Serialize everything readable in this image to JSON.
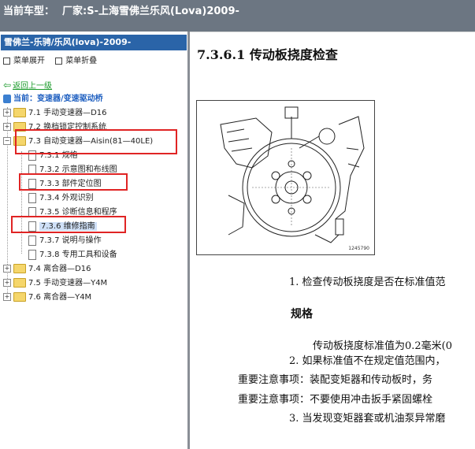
{
  "top_bar": {
    "car_model_label": "当前车型：",
    "manufacturer": "厂家:S-上海雪佛兰乐风(Lova)2009-"
  },
  "left_panel": {
    "header": "雪佛兰-乐骋/乐风(lova)-2009-",
    "expand_label": "菜单展开",
    "collapse_label": "菜单折叠",
    "back_link": "返回上一级",
    "current_path": "当前：变速器/变速驱动桥",
    "tree": [
      {
        "label": "7.1 手动变速器—D16",
        "type": "folder"
      },
      {
        "label": "7.2 换档锁定控制系统",
        "type": "folder"
      },
      {
        "label": "7.3 自动变速器—Aisin(81—40LE)",
        "type": "folder",
        "expanded": true
      },
      {
        "label": "7.3.1 规格",
        "type": "doc"
      },
      {
        "label": "7.3.2 示意图和布线图",
        "type": "doc"
      },
      {
        "label": "7.3.3 部件定位图",
        "type": "doc"
      },
      {
        "label": "7.3.4 外观识别",
        "type": "doc"
      },
      {
        "label": "7.3.5 诊断信息和程序",
        "type": "doc"
      },
      {
        "label": "7.3.6 维修指南",
        "type": "doc",
        "selected": true
      },
      {
        "label": "7.3.7 说明与操作",
        "type": "doc"
      },
      {
        "label": "7.3.8 专用工具和设备",
        "type": "doc"
      },
      {
        "label": "7.4 离合器—D16",
        "type": "folder"
      },
      {
        "label": "7.5 手动变速器—Y4M",
        "type": "folder"
      },
      {
        "label": "7.6 离合器—Y4M",
        "type": "folder"
      }
    ]
  },
  "content": {
    "title": "7.3.6.1 传动板挠度检查",
    "figure_number": "1245790",
    "step1": "1. 检查传动板挠度是否在标准值范",
    "spec_heading": "规格",
    "spec_text": "传动板挠度标准值为0.2毫米(0",
    "step2": "2. 如果标准值不在规定值范围内，",
    "note1": "重要注意事项：装配变矩器和传动板时，务",
    "note2": "重要注意事项：不要使用冲击扳手紧固螺栓",
    "step3": "3. 当发现变矩器套或机油泵异常磨"
  },
  "colors": {
    "top_bar": "#6c7682",
    "left_header": "#2a64a8",
    "highlight_box": "#e02424",
    "link_green": "#1a9a2a"
  }
}
